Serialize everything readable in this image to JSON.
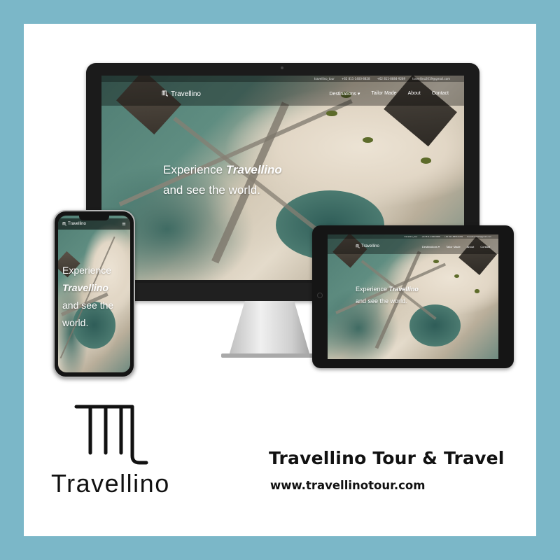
{
  "site": {
    "brand": "Travellino",
    "topbar": {
      "instagram": "travellino_tour",
      "phone_1": "+62 811-1400-8828",
      "phone_2": "+62 811-8884-9289",
      "email": "travellino2019@gmail.com"
    },
    "nav": [
      "Destinations ▾",
      "Tailor Made",
      "About",
      "Contact"
    ],
    "hero": {
      "line1_prefix": "Experience ",
      "line1_brand": "Travellino",
      "line2": "and see the world."
    },
    "mobile_menu_icon": "≡"
  },
  "footer_brand": {
    "wordmark": "Travellino",
    "company_name": "Travellino Tour & Travel",
    "website": "www.travellinotour.com"
  },
  "colors": {
    "border": "#7bb7c8",
    "card": "#ffffff",
    "text": "#111111"
  }
}
